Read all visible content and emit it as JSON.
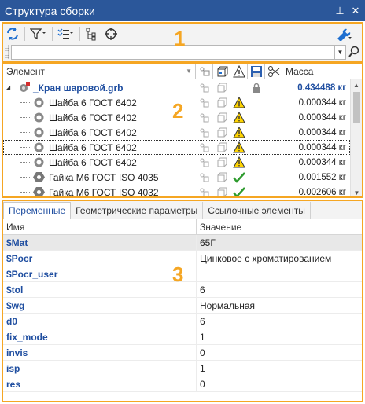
{
  "window": {
    "title": "Структура сборки",
    "pin_glyph": "⊥",
    "close_glyph": "✕"
  },
  "annotations": {
    "region1": "1",
    "region2": "2",
    "region3": "3"
  },
  "toolbar": {
    "icons": [
      "refresh-icon",
      "filter-icon",
      "list-settings-icon",
      "tree-structure-icon",
      "crosshair-icon",
      "wrench-icon"
    ]
  },
  "search": {
    "value": "",
    "placeholder": ""
  },
  "tree": {
    "columns": {
      "element": "Элемент",
      "mass": "Масса"
    },
    "rows": [
      {
        "name": "_Кран шаровой.grb",
        "mass": "0.434488 кг",
        "status": "lock",
        "root": true
      },
      {
        "name": "Шайба 6 ГОСТ 6402",
        "mass": "0.000344 кг",
        "status": "warning"
      },
      {
        "name": "Шайба 6 ГОСТ 6402",
        "mass": "0.000344 кг",
        "status": "warning"
      },
      {
        "name": "Шайба 6 ГОСТ 6402",
        "mass": "0.000344 кг",
        "status": "warning"
      },
      {
        "name": "Шайба 6 ГОСТ 6402",
        "mass": "0.000344 кг",
        "status": "warning",
        "focused": true
      },
      {
        "name": "Шайба 6 ГОСТ 6402",
        "mass": "0.000344 кг",
        "status": "warning"
      },
      {
        "name": "Гайка М6 ГОСТ ISO 4035",
        "mass": "0.001552 кг",
        "status": "ok"
      },
      {
        "name": "Гайка М6 ГОСТ ISO 4032",
        "mass": "0.002606 кг",
        "status": "ok"
      }
    ]
  },
  "tabs": [
    {
      "label": "Переменные",
      "active": true
    },
    {
      "label": "Геометрические параметры",
      "active": false
    },
    {
      "label": "Ссылочные элементы",
      "active": false
    }
  ],
  "properties": {
    "columns": {
      "name": "Имя",
      "value": "Значение"
    },
    "rows": [
      {
        "name": "$Mat",
        "value": "65Г"
      },
      {
        "name": "$Pocr",
        "value": "Цинковое с хроматированием"
      },
      {
        "name": "$Pocr_user",
        "value": ""
      },
      {
        "name": "$tol",
        "value": "6"
      },
      {
        "name": "$wg",
        "value": "Нормальная"
      },
      {
        "name": "d0",
        "value": "6"
      },
      {
        "name": "fix_mode",
        "value": "1"
      },
      {
        "name": "invis",
        "value": "0"
      },
      {
        "name": "isp",
        "value": "1"
      },
      {
        "name": "res",
        "value": "0"
      }
    ]
  },
  "colors": {
    "titlebar": "#2b579a",
    "accent_orange": "#f5a623",
    "link_blue": "#1f4ea0"
  }
}
